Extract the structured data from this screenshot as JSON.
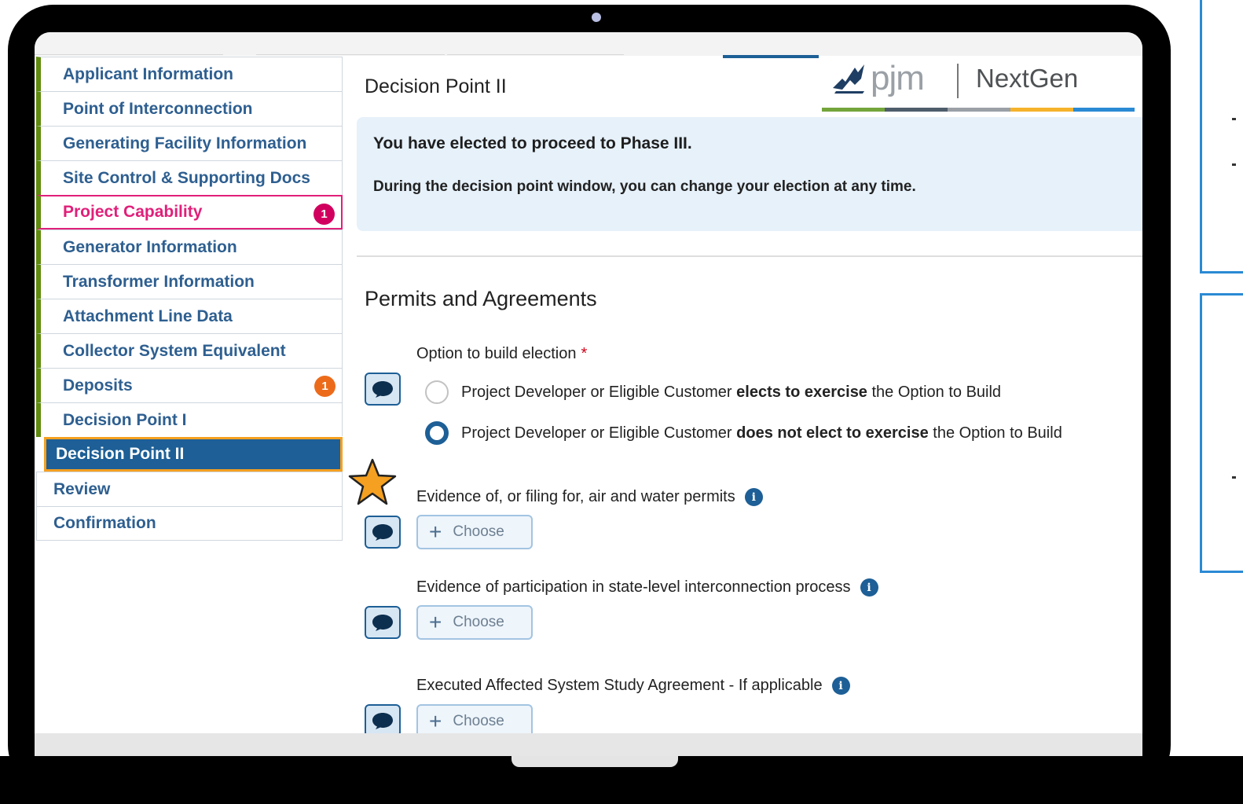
{
  "sidebar": {
    "items": [
      {
        "label": "Applicant Information",
        "status": "complete"
      },
      {
        "label": "Point of Interconnection",
        "status": "complete"
      },
      {
        "label": "Generating Facility Information",
        "status": "complete"
      },
      {
        "label": "Site Control & Supporting Docs",
        "status": "complete"
      },
      {
        "label": "Project Capability",
        "status": "error",
        "badge": "1"
      },
      {
        "label": "Generator Information",
        "status": "complete"
      },
      {
        "label": "Transformer Information",
        "status": "complete"
      },
      {
        "label": "Attachment Line Data",
        "status": "complete"
      },
      {
        "label": "Collector System Equivalent",
        "status": "complete"
      },
      {
        "label": "Deposits",
        "status": "warning",
        "badge": "1"
      },
      {
        "label": "Decision Point I",
        "status": "complete"
      },
      {
        "label": "Decision Point II",
        "status": "active"
      },
      {
        "label": "Review",
        "status": "none"
      },
      {
        "label": "Confirmation",
        "status": "none"
      }
    ]
  },
  "logo": {
    "brand": "pjm",
    "product": "NextGen"
  },
  "main": {
    "title": "Decision Point II",
    "banner": {
      "heading": "You have elected to proceed to Phase III.",
      "text": "During the decision point window, you can change your election at any time."
    },
    "section_title": "Permits and Agreements",
    "option_field": {
      "label": "Option to build election",
      "required_mark": "*",
      "options": [
        {
          "pre": "Project Developer or Eligible Customer ",
          "bold": "elects to exercise",
          "post": " the Option to Build",
          "checked": false
        },
        {
          "pre": "Project Developer or Eligible Customer ",
          "bold": "does not elect to exercise",
          "post": " the Option to Build",
          "checked": true
        }
      ]
    },
    "uploads": [
      {
        "label": "Evidence of, or filing for, air and water permits",
        "button": "Choose"
      },
      {
        "label": "Evidence of participation in state-level interconnection process",
        "button": "Choose"
      },
      {
        "label": "Executed Affected System Study Agreement - If applicable",
        "button": "Choose"
      }
    ],
    "info_glyph": "i"
  },
  "colors": {
    "accent": "#1d5f96",
    "complete": "#5f8b0e",
    "error": "#e0207a",
    "warning": "#ec6b1a",
    "highlight": "#f5a020"
  },
  "icons": {
    "comment": "comment-icon",
    "info": "info-icon",
    "plus": "plus-icon",
    "star": "star-icon"
  }
}
